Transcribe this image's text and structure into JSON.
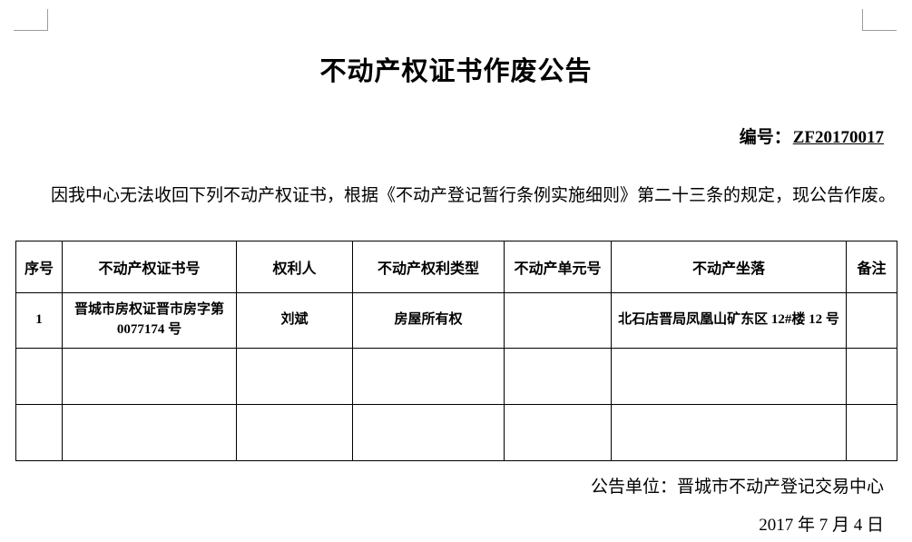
{
  "document": {
    "title": "不动产权证书作废公告",
    "serial": {
      "label": "编号：",
      "value": "ZF20170017"
    },
    "body_text": "因我中心无法收回下列不动产权证书，根据《不动产登记暂行条例实施细则》第二十三条的规定，现公告作废。",
    "table": {
      "headers": [
        "序号",
        "不动产权证书号",
        "权利人",
        "不动产权利类型",
        "不动产单元号",
        "不动产坐落",
        "备注"
      ],
      "rows": [
        {
          "seq": "1",
          "cert_no": "晋城市房权证晋市房字第 0077174 号",
          "owner": "刘斌",
          "right_type": "房屋所有权",
          "unit_no": "",
          "location": "北石店晋局凤凰山矿东区 12#楼 12 号",
          "note": ""
        },
        {
          "seq": "",
          "cert_no": "",
          "owner": "",
          "right_type": "",
          "unit_no": "",
          "location": "",
          "note": ""
        },
        {
          "seq": "",
          "cert_no": "",
          "owner": "",
          "right_type": "",
          "unit_no": "",
          "location": "",
          "note": ""
        }
      ]
    },
    "footer": {
      "issuer": "公告单位：晋城市不动产登记交易中心",
      "date": "2017 年 7 月 4 日"
    }
  },
  "colors": {
    "text": "#000000",
    "border": "#000000",
    "crop_mark": "#9a9da0",
    "page_background": "#ffffff"
  }
}
